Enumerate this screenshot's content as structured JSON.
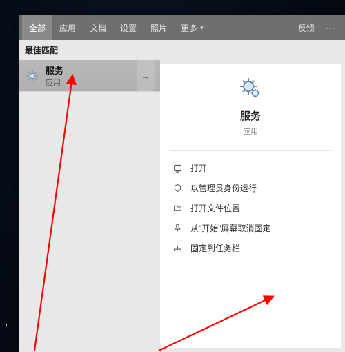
{
  "tabs": {
    "all": "全部",
    "apps": "应用",
    "docs": "文档",
    "settings": "设置",
    "photos": "照片",
    "more": "更多"
  },
  "header": {
    "feedback": "反馈"
  },
  "section": {
    "best_match": "最佳匹配"
  },
  "result": {
    "title": "服务",
    "subtitle": "应用"
  },
  "details": {
    "title": "服务",
    "subtitle": "应用",
    "actions": {
      "open": "打开",
      "run_as_admin": "以管理员身份运行",
      "open_file_location": "打开文件位置",
      "unpin_from_start": "从\"开始\"屏幕取消固定",
      "pin_to_taskbar": "固定到任务栏"
    }
  }
}
